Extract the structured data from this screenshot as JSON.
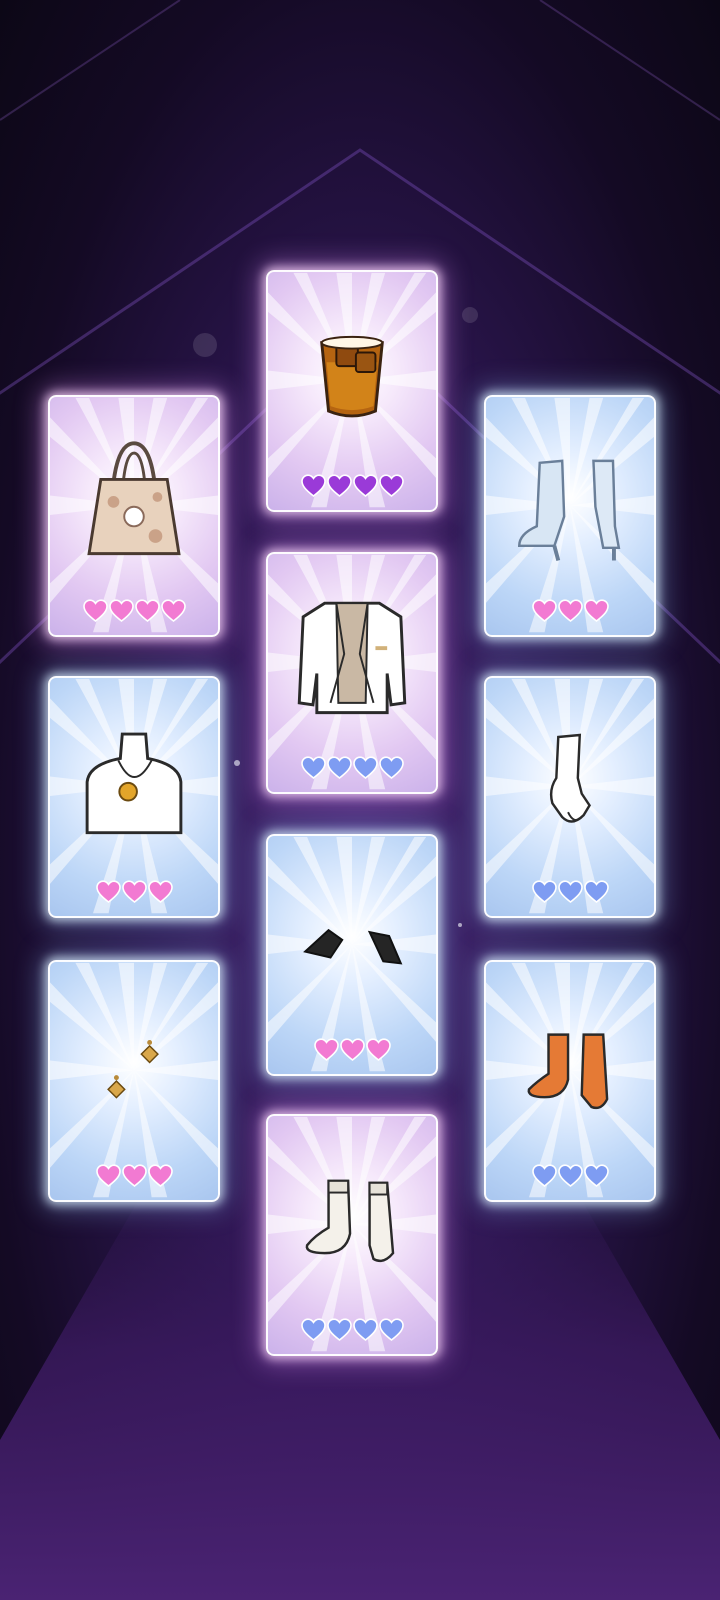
{
  "colors": {
    "heart_pink": "#f27ad2",
    "heart_blue": "#7e9cf2",
    "heart_purple": "#9a3ad8",
    "heart_outline": "#ffffff"
  },
  "cards": [
    {
      "id": "whiskey",
      "item": "whiskey-glass-icon",
      "theme": "pink",
      "hearts": 4,
      "heart_color": "purple"
    },
    {
      "id": "handbag",
      "item": "handbag-icon",
      "theme": "pink",
      "hearts": 4,
      "heart_color": "pink"
    },
    {
      "id": "boots",
      "item": "boots-icon",
      "theme": "blue",
      "hearts": 3,
      "heart_color": "pink"
    },
    {
      "id": "blazer",
      "item": "blazer-icon",
      "theme": "pink",
      "hearts": 4,
      "heart_color": "blue"
    },
    {
      "id": "necklace",
      "item": "necklace-icon",
      "theme": "blue",
      "hearts": 3,
      "heart_color": "pink"
    },
    {
      "id": "glove",
      "item": "glove-icon",
      "theme": "blue",
      "hearts": 3,
      "heart_color": "blue"
    },
    {
      "id": "cuffs",
      "item": "cuffs-icon",
      "theme": "blue",
      "hearts": 3,
      "heart_color": "pink"
    },
    {
      "id": "earrings",
      "item": "earrings-icon",
      "theme": "blue",
      "hearts": 3,
      "heart_color": "pink"
    },
    {
      "id": "socks-orange",
      "item": "orange-socks-icon",
      "theme": "blue",
      "hearts": 3,
      "heart_color": "blue"
    },
    {
      "id": "socks-white",
      "item": "white-socks-icon",
      "theme": "pink",
      "hearts": 4,
      "heart_color": "blue"
    }
  ]
}
